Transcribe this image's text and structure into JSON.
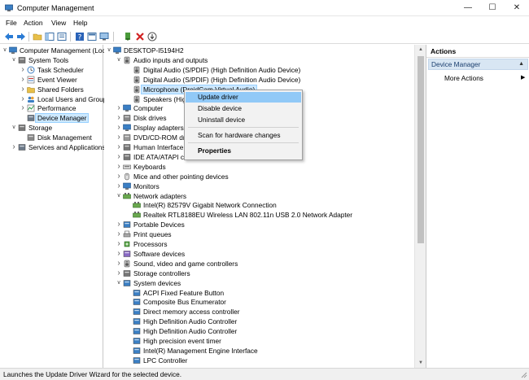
{
  "window": {
    "title": "Computer Management"
  },
  "menu": [
    "File",
    "Action",
    "View",
    "Help"
  ],
  "left_tree": [
    {
      "label": "Computer Management (Local)",
      "indent": 0,
      "expander": "v",
      "icon": "computer"
    },
    {
      "label": "System Tools",
      "indent": 1,
      "expander": "v",
      "icon": "tools"
    },
    {
      "label": "Task Scheduler",
      "indent": 2,
      "expander": ">",
      "icon": "clock"
    },
    {
      "label": "Event Viewer",
      "indent": 2,
      "expander": ">",
      "icon": "event"
    },
    {
      "label": "Shared Folders",
      "indent": 2,
      "expander": ">",
      "icon": "folder"
    },
    {
      "label": "Local Users and Groups",
      "indent": 2,
      "expander": ">",
      "icon": "users"
    },
    {
      "label": "Performance",
      "indent": 2,
      "expander": ">",
      "icon": "perf"
    },
    {
      "label": "Device Manager",
      "indent": 2,
      "expander": "",
      "icon": "devmgr",
      "selected": true
    },
    {
      "label": "Storage",
      "indent": 1,
      "expander": "v",
      "icon": "storage"
    },
    {
      "label": "Disk Management",
      "indent": 2,
      "expander": "",
      "icon": "disk"
    },
    {
      "label": "Services and Applications",
      "indent": 1,
      "expander": ">",
      "icon": "services"
    }
  ],
  "device_tree": [
    {
      "label": "DESKTOP-I5194H2",
      "indent": 0,
      "expander": "v",
      "icon": "computer"
    },
    {
      "label": "Audio inputs and outputs",
      "indent": 1,
      "expander": "v",
      "icon": "audio"
    },
    {
      "label": "Digital Audio (S/PDIF) (High Definition Audio Device)",
      "indent": 2,
      "expander": "",
      "icon": "audio"
    },
    {
      "label": "Digital Audio (S/PDIF) (High Definition Audio Device)",
      "indent": 2,
      "expander": "",
      "icon": "audio"
    },
    {
      "label": "Microphone (DroidCam Virtual Audio)",
      "indent": 2,
      "expander": "",
      "icon": "audio",
      "selected": true
    },
    {
      "label": "Speakers (High Definition Audio Device)",
      "indent": 2,
      "expander": "",
      "icon": "audio"
    },
    {
      "label": "Computer",
      "indent": 1,
      "expander": ">",
      "icon": "computer"
    },
    {
      "label": "Disk drives",
      "indent": 1,
      "expander": ">",
      "icon": "disk"
    },
    {
      "label": "Display adapters",
      "indent": 1,
      "expander": ">",
      "icon": "display"
    },
    {
      "label": "DVD/CD-ROM drives",
      "indent": 1,
      "expander": ">",
      "icon": "dvd"
    },
    {
      "label": "Human Interface Devices",
      "indent": 1,
      "expander": ">",
      "icon": "hid"
    },
    {
      "label": "IDE ATA/ATAPI controllers",
      "indent": 1,
      "expander": ">",
      "icon": "ide"
    },
    {
      "label": "Keyboards",
      "indent": 1,
      "expander": ">",
      "icon": "keyboard"
    },
    {
      "label": "Mice and other pointing devices",
      "indent": 1,
      "expander": ">",
      "icon": "mouse"
    },
    {
      "label": "Monitors",
      "indent": 1,
      "expander": ">",
      "icon": "display"
    },
    {
      "label": "Network adapters",
      "indent": 1,
      "expander": "v",
      "icon": "network"
    },
    {
      "label": "Intel(R) 82579V Gigabit Network Connection",
      "indent": 2,
      "expander": "",
      "icon": "network"
    },
    {
      "label": "Realtek RTL8188EU Wireless LAN 802.11n USB 2.0 Network Adapter",
      "indent": 2,
      "expander": "",
      "icon": "network"
    },
    {
      "label": "Portable Devices",
      "indent": 1,
      "expander": ">",
      "icon": "portable"
    },
    {
      "label": "Print queues",
      "indent": 1,
      "expander": ">",
      "icon": "printer"
    },
    {
      "label": "Processors",
      "indent": 1,
      "expander": ">",
      "icon": "cpu"
    },
    {
      "label": "Software devices",
      "indent": 1,
      "expander": ">",
      "icon": "software"
    },
    {
      "label": "Sound, video and game controllers",
      "indent": 1,
      "expander": ">",
      "icon": "audio"
    },
    {
      "label": "Storage controllers",
      "indent": 1,
      "expander": ">",
      "icon": "storage"
    },
    {
      "label": "System devices",
      "indent": 1,
      "expander": "v",
      "icon": "system"
    },
    {
      "label": "ACPI Fixed Feature Button",
      "indent": 2,
      "expander": "",
      "icon": "system"
    },
    {
      "label": "Composite Bus Enumerator",
      "indent": 2,
      "expander": "",
      "icon": "system"
    },
    {
      "label": "Direct memory access controller",
      "indent": 2,
      "expander": "",
      "icon": "system"
    },
    {
      "label": "High Definition Audio Controller",
      "indent": 2,
      "expander": "",
      "icon": "system"
    },
    {
      "label": "High Definition Audio Controller",
      "indent": 2,
      "expander": "",
      "icon": "system"
    },
    {
      "label": "High precision event timer",
      "indent": 2,
      "expander": "",
      "icon": "system"
    },
    {
      "label": "Intel(R) Management Engine Interface",
      "indent": 2,
      "expander": "",
      "icon": "system"
    },
    {
      "label": "LPC Controller",
      "indent": 2,
      "expander": "",
      "icon": "system"
    }
  ],
  "actions": {
    "title": "Actions",
    "section": "Device Manager",
    "more": "More Actions"
  },
  "context_menu": {
    "update": "Update driver",
    "disable": "Disable device",
    "uninstall": "Uninstall device",
    "scan": "Scan for hardware changes",
    "properties": "Properties"
  },
  "status": "Launches the Update Driver Wizard for the selected device.",
  "colors": {
    "selection": "#cce8ff",
    "menu_highlight": "#91c9f7",
    "actions_header": "#d8e6f3"
  }
}
